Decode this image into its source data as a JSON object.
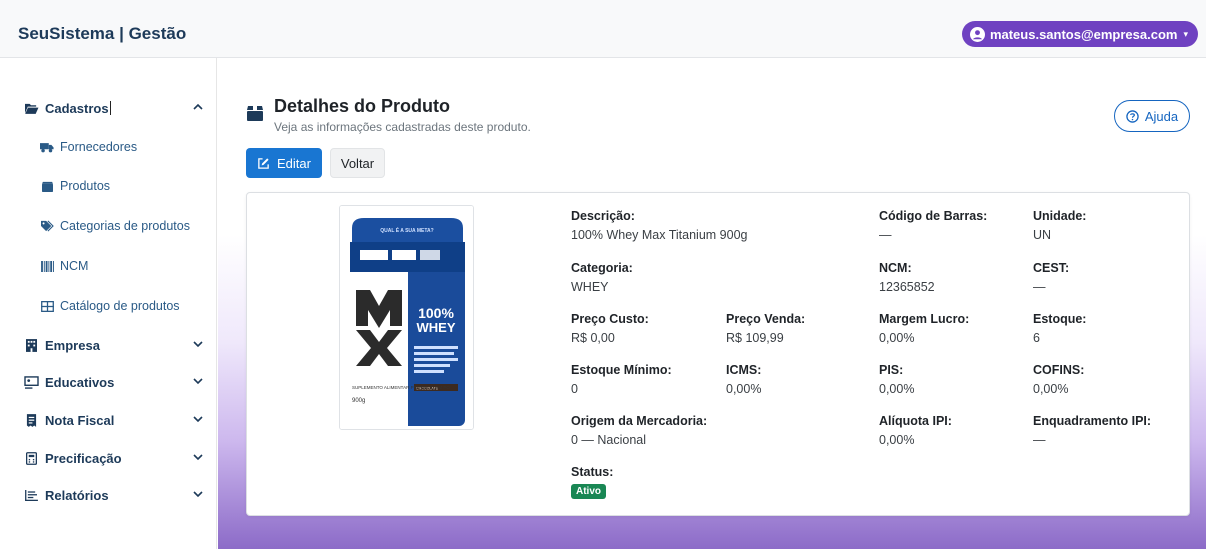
{
  "brand": "SeuSistema | Gestão",
  "user": {
    "email": "mateus.santos@empresa.com",
    "caret": "▾"
  },
  "sidebar": {
    "sections": [
      {
        "label": "Cadastros",
        "icon": "folder-open-icon",
        "expanded": true
      },
      {
        "label": "Empresa",
        "icon": "building-icon",
        "expanded": false
      },
      {
        "label": "Educativos",
        "icon": "chalkboard-icon",
        "expanded": false
      },
      {
        "label": "Nota Fiscal",
        "icon": "receipt-icon",
        "expanded": false
      },
      {
        "label": "Precificação",
        "icon": "calculator-icon",
        "expanded": false
      },
      {
        "label": "Relatórios",
        "icon": "list-icon",
        "expanded": false
      }
    ],
    "cadastros_items": [
      {
        "label": "Fornecedores",
        "icon": "truck-icon"
      },
      {
        "label": "Produtos",
        "icon": "box-icon"
      },
      {
        "label": "Categorias de produtos",
        "icon": "tags-icon"
      },
      {
        "label": "NCM",
        "icon": "barcode-icon"
      },
      {
        "label": "Catálogo de produtos",
        "icon": "table-icon"
      }
    ]
  },
  "page": {
    "title": "Detalhes do Produto",
    "subtitle": "Veja as informações cadastradas deste produto.",
    "help_label": "Ajuda",
    "edit_label": "Editar",
    "back_label": "Voltar"
  },
  "product_image": {
    "banner": "QUAL É A SUA META?",
    "brand_text": "100%",
    "brand_text2": "WHEY",
    "side_text": "SUPLEMENTO ALIMENTAR PROTEICO EM PÓ",
    "weight": "900g",
    "flavor": "CHOCOLATE"
  },
  "fields": {
    "descricao": {
      "label": "Descrição:",
      "value": "100% Whey Max Titanium 900g"
    },
    "codigo_barras": {
      "label": "Código de Barras:",
      "value": "—"
    },
    "unidade": {
      "label": "Unidade:",
      "value": "UN"
    },
    "categoria": {
      "label": "Categoria:",
      "value": "WHEY"
    },
    "ncm": {
      "label": "NCM:",
      "value": "12365852"
    },
    "cest": {
      "label": "CEST:",
      "value": "—"
    },
    "preco_custo": {
      "label": "Preço Custo:",
      "value": "R$ 0,00"
    },
    "preco_venda": {
      "label": "Preço Venda:",
      "value": "R$ 109,99"
    },
    "margem_lucro": {
      "label": "Margem Lucro:",
      "value": "0,00%"
    },
    "estoque": {
      "label": "Estoque:",
      "value": "6"
    },
    "estoque_minimo": {
      "label": "Estoque Mínimo:",
      "value": "0"
    },
    "icms": {
      "label": "ICMS:",
      "value": "0,00%"
    },
    "pis": {
      "label": "PIS:",
      "value": "0,00%"
    },
    "cofins": {
      "label": "COFINS:",
      "value": "0,00%"
    },
    "origem": {
      "label": "Origem da Mercadoria:",
      "value": "0 — Nacional"
    },
    "aliquota_ipi": {
      "label": "Alíquota IPI:",
      "value": "0,00%"
    },
    "enquadramento_ipi": {
      "label": "Enquadramento IPI:",
      "value": "—"
    },
    "status": {
      "label": "Status:",
      "value": "Ativo"
    }
  },
  "colors": {
    "accent": "#6f42c1",
    "primary": "#1976d2",
    "brand_text": "#1d3a59",
    "status_green": "#198754"
  }
}
